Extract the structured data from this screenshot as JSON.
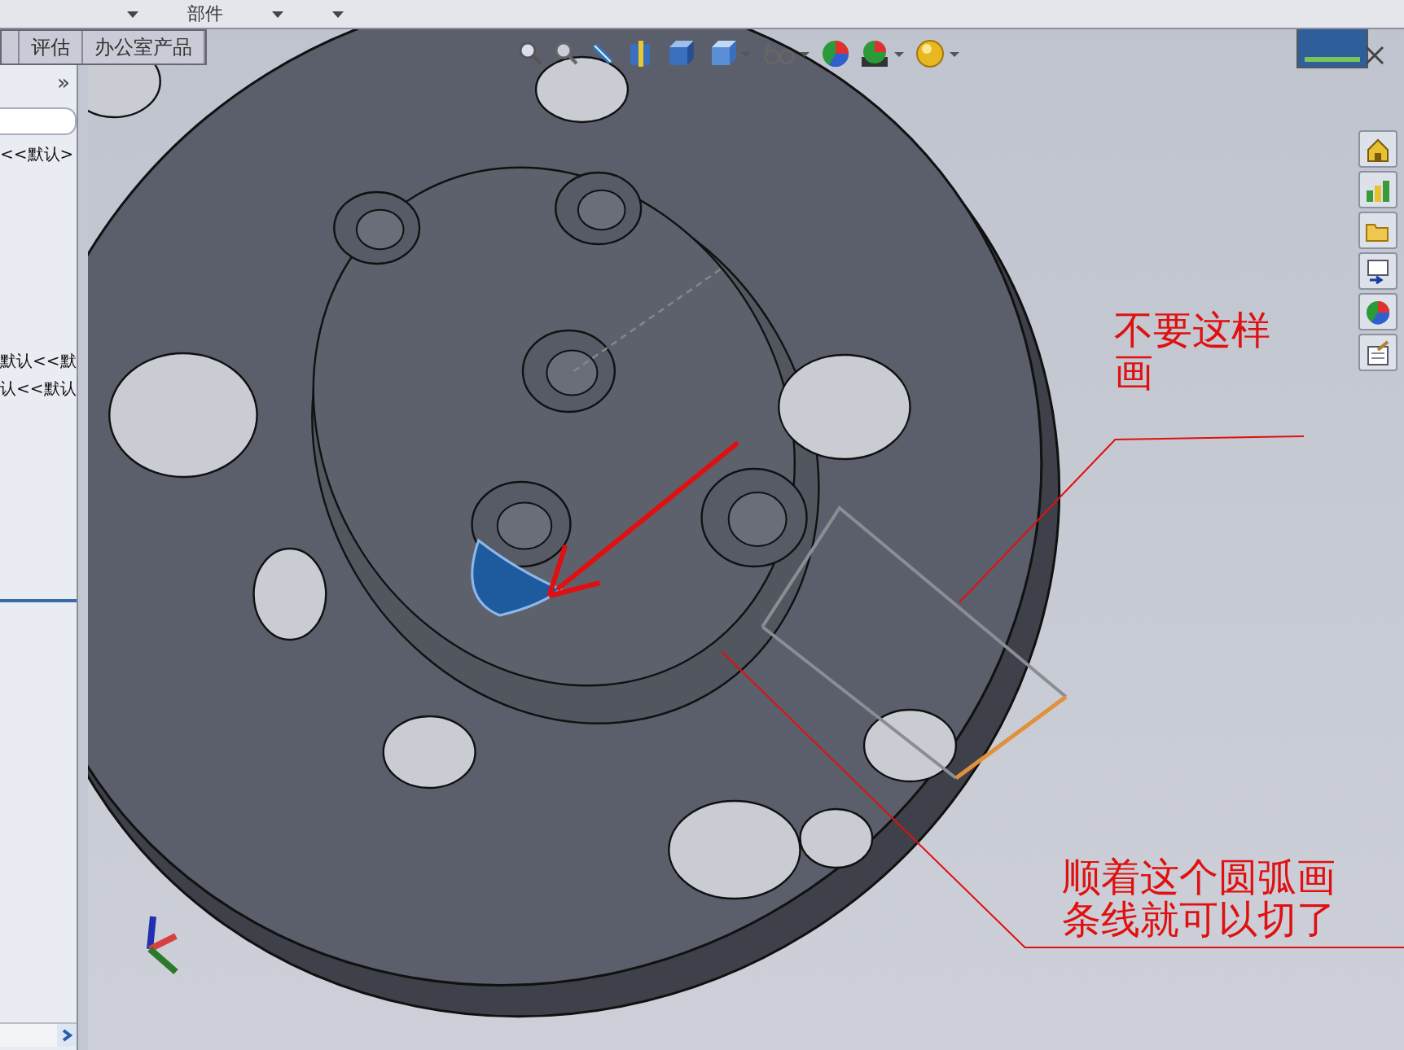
{
  "top_bar": {
    "label": "部件"
  },
  "tabs": [
    {
      "label": "评估",
      "selected": false
    },
    {
      "label": "办公室产品",
      "selected": false
    }
  ],
  "left_panel": {
    "collapse": "»",
    "items": [
      {
        "text": "<<默认>"
      },
      {
        "text": "默认<<默"
      },
      {
        "text": "认<<默认"
      }
    ]
  },
  "annotations": [
    {
      "text": "不要这样画"
    },
    {
      "text": "顺着这个圆弧画条线就可以切了"
    }
  ]
}
